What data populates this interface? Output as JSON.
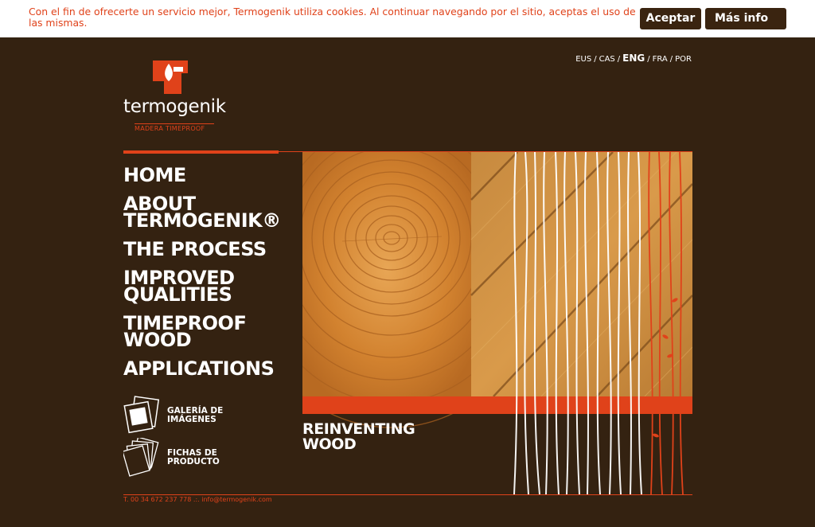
{
  "cookie_bar": {
    "message": "Con el fin de ofrecerte un servicio mejor, Termogenik utiliza cookies. Al continuar navegando por el sitio, aceptas el uso de las mismas.",
    "accept_label": "Aceptar",
    "more_info_label": "Más info"
  },
  "brand": {
    "name": "termogenik",
    "tagline": "MADERA TIMEPROOF"
  },
  "languages": {
    "items": [
      "EUS",
      "CAS",
      "ENG",
      "FRA",
      "POR"
    ],
    "active": "ENG",
    "separator": "/"
  },
  "nav": {
    "home": "HOME",
    "about_1": "ABOUT",
    "about_2": "TERMOGENIK®",
    "process": "THE PROCESS",
    "improved_1": "IMPROVED",
    "improved_2": "QUALITIES",
    "timeproof_1": "TIMEPROOF",
    "timeproof_2": "WOOD",
    "applications": "APPLICATIONS"
  },
  "side_links": {
    "gallery_1": "GALERÍA DE",
    "gallery_2": "IMÁGENES",
    "sheets_1": "FICHAS DE",
    "sheets_2": "PRODUCTO"
  },
  "hero": {
    "tagline_1": "REINVENTING",
    "tagline_2": "WOOD"
  },
  "footer": {
    "phone": "T. 00 34 672 237 778",
    "separator": ".:.",
    "email": "info@termogenik.com"
  },
  "colors": {
    "accent": "#e0421a",
    "background": "#342211",
    "button": "#3a2410"
  }
}
